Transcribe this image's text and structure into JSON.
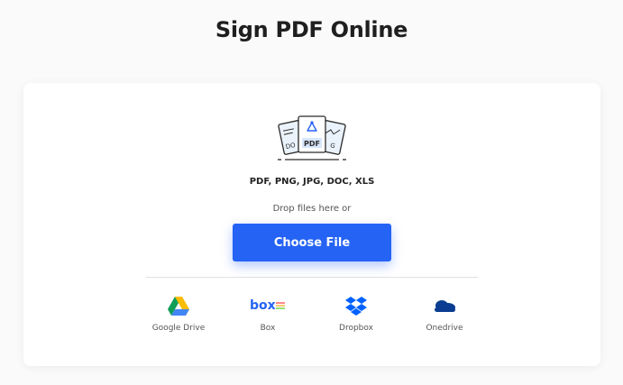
{
  "page": {
    "title": "Sign PDF Online"
  },
  "uploader": {
    "illustration_badge": "PDF",
    "illustration_left_text": "DO",
    "illustration_right_text": "G",
    "formats": "PDF, PNG, JPG, DOC, XLS",
    "drop_hint": "Drop files here or",
    "choose_button": "Choose File"
  },
  "sources": [
    {
      "label": "Google Drive",
      "icon": "google-drive-icon"
    },
    {
      "label": "Box",
      "icon": "box-icon",
      "logo_text": "box"
    },
    {
      "label": "Dropbox",
      "icon": "dropbox-icon"
    },
    {
      "label": "Onedrive",
      "icon": "onedrive-icon"
    }
  ],
  "colors": {
    "accent": "#2563f5",
    "background": "#fafafa",
    "card": "#ffffff",
    "title": "#1f1f1f"
  }
}
